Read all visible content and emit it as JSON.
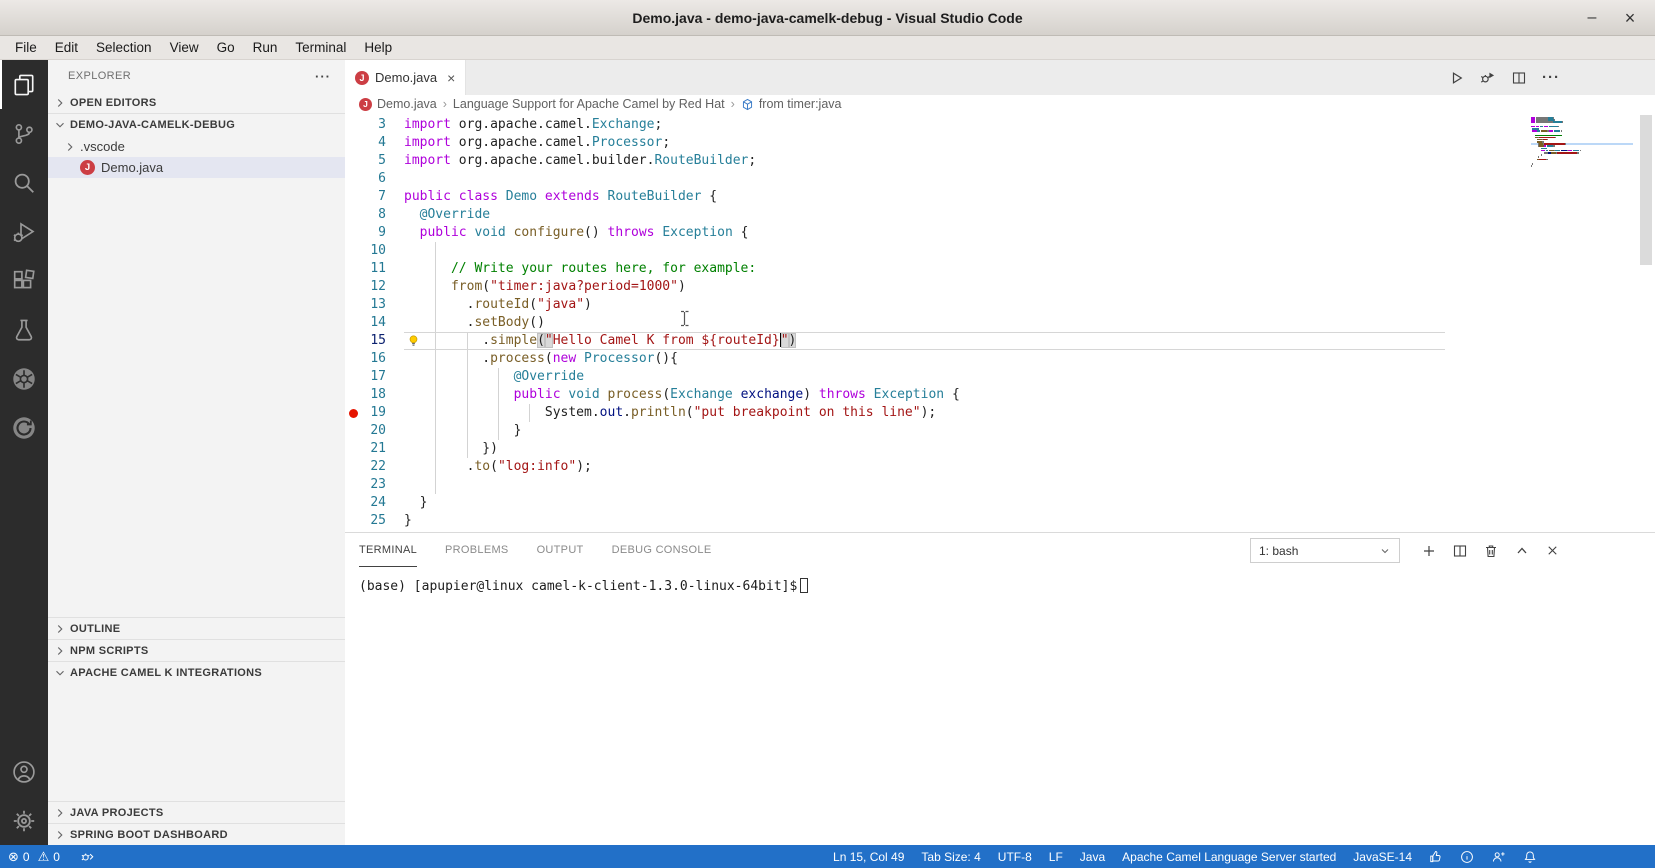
{
  "window": {
    "title": "Demo.java - demo-java-camelk-debug - Visual Studio Code",
    "minimize_glyph": "–",
    "close_glyph": "×"
  },
  "menubar": {
    "items": [
      "File",
      "Edit",
      "Selection",
      "View",
      "Go",
      "Run",
      "Terminal",
      "Help"
    ]
  },
  "activitybar": {
    "top_icons": [
      "explorer-icon",
      "source-control-icon",
      "search-icon",
      "run-debug-icon",
      "extensions-icon",
      "test-beaker-icon",
      "kubernetes-icon",
      "refresh-circle-icon"
    ],
    "bottom_icons": [
      "account-icon",
      "settings-gear-icon"
    ],
    "active": "explorer-icon"
  },
  "sidebar": {
    "title": "EXPLORER",
    "more_glyph": "···",
    "open_editors": {
      "label": "OPEN EDITORS",
      "expanded": false
    },
    "workspace": {
      "label": "DEMO-JAVA-CAMELK-DEBUG",
      "expanded": true,
      "items": [
        {
          "label": ".vscode",
          "type": "folder",
          "selected": false
        },
        {
          "label": "Demo.java",
          "type": "java-file",
          "selected": true,
          "icon_letter": "J"
        }
      ]
    },
    "sections": [
      {
        "label": "OUTLINE",
        "expanded": false
      },
      {
        "label": "NPM SCRIPTS",
        "expanded": false
      },
      {
        "label": "APACHE CAMEL K INTEGRATIONS",
        "expanded": true
      },
      {
        "label": "JAVA PROJECTS",
        "expanded": false
      },
      {
        "label": "SPRING BOOT DASHBOARD",
        "expanded": false
      }
    ]
  },
  "editor": {
    "tab": {
      "label": "Demo.java",
      "icon_letter": "J",
      "close_glyph": "×"
    },
    "more_glyph": "···",
    "breadcrumbs": [
      {
        "label": "Demo.java",
        "icon": "java-file-icon"
      },
      {
        "label": "Language Support for Apache Camel by Red Hat"
      },
      {
        "label": "from timer:java",
        "icon": "camel-route-icon"
      }
    ],
    "code": {
      "lines": [
        {
          "n": 3,
          "g": [],
          "t": [
            [
              "kw",
              "import"
            ],
            [
              "pl",
              " org.apache.camel."
            ],
            [
              "ty",
              "Exchange"
            ],
            [
              "pl",
              ";"
            ]
          ]
        },
        {
          "n": 4,
          "g": [],
          "t": [
            [
              "kw",
              "import"
            ],
            [
              "pl",
              " org.apache.camel."
            ],
            [
              "ty",
              "Processor"
            ],
            [
              "pl",
              ";"
            ]
          ]
        },
        {
          "n": 5,
          "g": [],
          "t": [
            [
              "kw",
              "import"
            ],
            [
              "pl",
              " org.apache.camel.builder."
            ],
            [
              "ty",
              "RouteBuilder"
            ],
            [
              "pl",
              ";"
            ]
          ]
        },
        {
          "n": 6,
          "g": [],
          "t": []
        },
        {
          "n": 7,
          "g": [],
          "t": [
            [
              "kw",
              "public"
            ],
            [
              "pl",
              " "
            ],
            [
              "kw",
              "class"
            ],
            [
              "pl",
              " "
            ],
            [
              "ty",
              "Demo"
            ],
            [
              "pl",
              " "
            ],
            [
              "kw",
              "extends"
            ],
            [
              "pl",
              " "
            ],
            [
              "ty",
              "RouteBuilder"
            ],
            [
              "pl",
              " {"
            ]
          ]
        },
        {
          "n": 8,
          "g": [],
          "t": [
            [
              "pl",
              "  "
            ],
            [
              "an",
              "@Override"
            ]
          ]
        },
        {
          "n": 9,
          "g": [],
          "t": [
            [
              "pl",
              "  "
            ],
            [
              "kw",
              "public"
            ],
            [
              "pl",
              " "
            ],
            [
              "ty",
              "void"
            ],
            [
              "pl",
              " "
            ],
            [
              "fn",
              "configure"
            ],
            [
              "pl",
              "() "
            ],
            [
              "kw",
              "throws"
            ],
            [
              "pl",
              " "
            ],
            [
              "ty",
              "Exception"
            ],
            [
              "pl",
              " {"
            ]
          ]
        },
        {
          "n": 10,
          "g": [
            4
          ],
          "t": []
        },
        {
          "n": 11,
          "g": [
            4
          ],
          "t": [
            [
              "pl",
              "      "
            ],
            [
              "cm",
              "// Write your routes here, for example:"
            ]
          ]
        },
        {
          "n": 12,
          "g": [
            4
          ],
          "t": [
            [
              "pl",
              "      "
            ],
            [
              "fn",
              "from"
            ],
            [
              "pl",
              "("
            ],
            [
              "st",
              "\"timer:java?period=1000\""
            ],
            [
              "pl",
              ")"
            ]
          ]
        },
        {
          "n": 13,
          "g": [
            4
          ],
          "t": [
            [
              "pl",
              "        ."
            ],
            [
              "fn",
              "routeId"
            ],
            [
              "pl",
              "("
            ],
            [
              "st",
              "\"java\""
            ],
            [
              "pl",
              ")"
            ]
          ]
        },
        {
          "n": 14,
          "g": [
            4
          ],
          "t": [
            [
              "pl",
              "        ."
            ],
            [
              "fn",
              "setBody"
            ],
            [
              "pl",
              "()"
            ]
          ]
        },
        {
          "n": 15,
          "g": [
            4,
            8
          ],
          "cur": true,
          "bulb": true,
          "t": [
            [
              "pl",
              "          ."
            ],
            [
              "fn",
              "simple"
            ],
            [
              "pl bm",
              "("
            ],
            [
              "st bm",
              "\""
            ],
            [
              "st",
              "Hello Camel K from ${routeId}"
            ],
            [
              "caret",
              ""
            ],
            [
              "st bm",
              "\""
            ],
            [
              "pl bm",
              ")"
            ]
          ]
        },
        {
          "n": 16,
          "g": [
            4,
            8
          ],
          "t": [
            [
              "pl",
              "          ."
            ],
            [
              "fn",
              "process"
            ],
            [
              "pl",
              "("
            ],
            [
              "kw",
              "new"
            ],
            [
              "pl",
              " "
            ],
            [
              "ty",
              "Processor"
            ],
            [
              "pl",
              "(){"
            ]
          ]
        },
        {
          "n": 17,
          "g": [
            4,
            8,
            12
          ],
          "t": [
            [
              "pl",
              "              "
            ],
            [
              "an",
              "@Override"
            ]
          ]
        },
        {
          "n": 18,
          "g": [
            4,
            8,
            12
          ],
          "t": [
            [
              "pl",
              "              "
            ],
            [
              "kw",
              "public"
            ],
            [
              "pl",
              " "
            ],
            [
              "ty",
              "void"
            ],
            [
              "pl",
              " "
            ],
            [
              "fn",
              "process"
            ],
            [
              "pl",
              "("
            ],
            [
              "ty",
              "Exchange"
            ],
            [
              "pl",
              " "
            ],
            [
              "va",
              "exchange"
            ],
            [
              "pl",
              ") "
            ],
            [
              "kw",
              "throws"
            ],
            [
              "pl",
              " "
            ],
            [
              "ty",
              "Exception"
            ],
            [
              "pl",
              " {"
            ]
          ]
        },
        {
          "n": 19,
          "g": [
            4,
            8,
            12,
            16
          ],
          "bp": true,
          "t": [
            [
              "pl",
              "                  System."
            ],
            [
              "va",
              "out"
            ],
            [
              "pl",
              "."
            ],
            [
              "fn",
              "println"
            ],
            [
              "pl",
              "("
            ],
            [
              "st",
              "\"put breakpoint on this line\""
            ],
            [
              "pl",
              ");"
            ]
          ]
        },
        {
          "n": 20,
          "g": [
            4,
            8,
            12
          ],
          "t": [
            [
              "pl",
              "              }"
            ]
          ]
        },
        {
          "n": 21,
          "g": [
            4,
            8
          ],
          "t": [
            [
              "pl",
              "          })"
            ]
          ]
        },
        {
          "n": 22,
          "g": [
            4
          ],
          "t": [
            [
              "pl",
              "        ."
            ],
            [
              "fn",
              "to"
            ],
            [
              "pl",
              "("
            ],
            [
              "st",
              "\"log:info\""
            ],
            [
              "pl",
              ");"
            ]
          ]
        },
        {
          "n": 23,
          "g": [
            4
          ],
          "t": []
        },
        {
          "n": 24,
          "g": [],
          "t": [
            [
              "pl",
              "  }"
            ]
          ]
        },
        {
          "n": 25,
          "g": [],
          "t": [
            [
              "pl",
              "}"
            ]
          ]
        }
      ],
      "cursor_line": 15,
      "cursor_col": 49,
      "breakpoint_line": 19
    }
  },
  "panel": {
    "tabs": [
      {
        "label": "TERMINAL",
        "active": true
      },
      {
        "label": "PROBLEMS",
        "active": false
      },
      {
        "label": "OUTPUT",
        "active": false
      },
      {
        "label": "DEBUG CONSOLE",
        "active": false
      }
    ],
    "shell_select": "1: bash",
    "terminal_prompt": "(base) [apupier@linux camel-k-client-1.3.0-linux-64bit]$"
  },
  "statusbar": {
    "errors": "0",
    "warnings": "0",
    "error_glyph": "⊗",
    "warning_glyph": "⚠",
    "right_items": [
      "Ln 15, Col 49",
      "Tab Size: 4",
      "UTF-8",
      "LF",
      "Java",
      "Apache Camel Language Server started",
      "JavaSE-14"
    ],
    "right_icons": [
      "like-icon",
      "info-icon",
      "feedback-icon",
      "bell-icon"
    ]
  },
  "colors": {
    "statusbar_bg": "#2270c8",
    "activitybar_bg": "#2c2c2c",
    "sidebar_bg": "#f3f3f3",
    "selection_bg": "#e4e6f1",
    "java_icon_red": "#cc3e44",
    "breakpoint_red": "#e51400",
    "lightbulb_yellow": "#ffcc00",
    "keyword": "#af00db",
    "type_name": "#267f99",
    "function_name": "#795e26",
    "string_literal": "#a31515",
    "comment": "#008000",
    "variable": "#001080",
    "line_number": "#237893",
    "camel_icon_blue": "#3d7dc8"
  }
}
